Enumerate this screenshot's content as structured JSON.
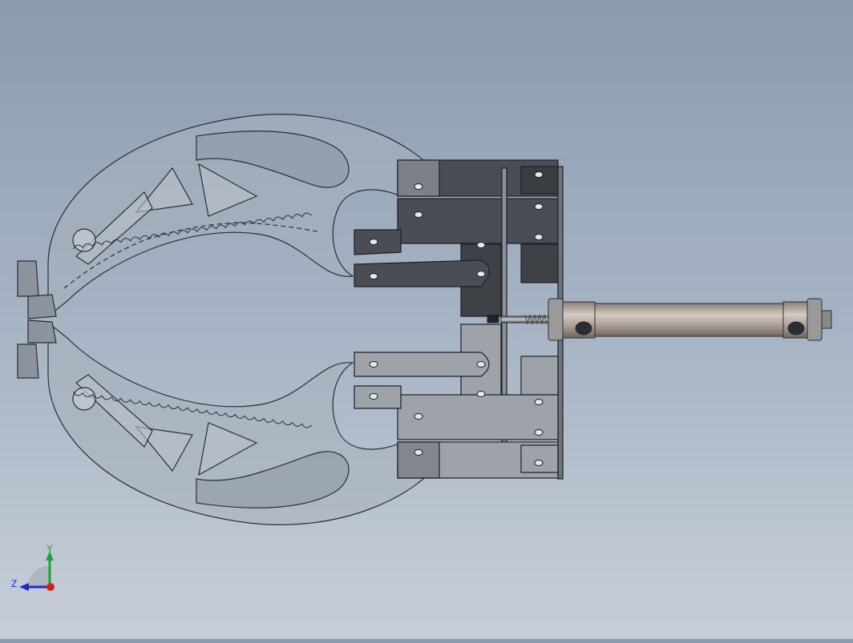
{
  "viewport": {
    "background_top": "#8a9bb0",
    "background_bottom": "#c7ced8",
    "model": "gripper-assembly"
  },
  "colors": {
    "jaw_fill": "#a8b0bc",
    "edge": "#2a2e35",
    "plate_dark": "#4a4d53",
    "plate_mid": "#9ea3aa",
    "cylinder": "#b7aaa0"
  },
  "triad": {
    "y_label": "Y",
    "z_label": "Z",
    "y_color": "#1aa53a",
    "z_color": "#1d2bd0",
    "x_color": "#d2231b"
  }
}
